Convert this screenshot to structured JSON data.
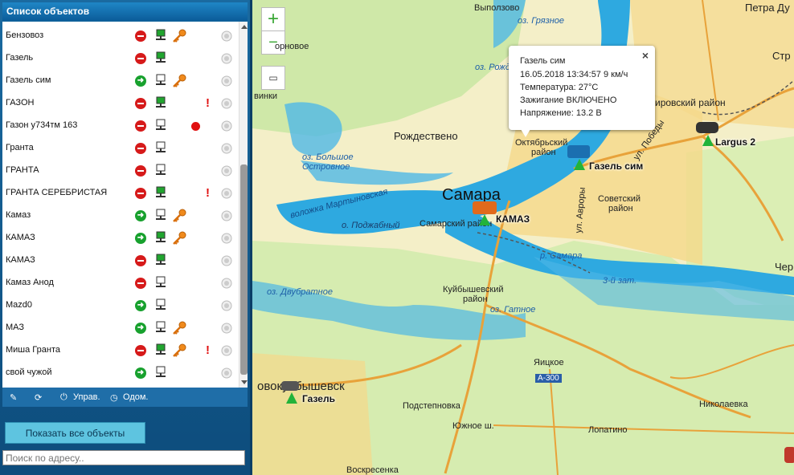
{
  "panel": {
    "title": "Список объектов",
    "objects": [
      {
        "name": "Бензовоз",
        "status": "stopped",
        "gps": true,
        "key": true,
        "alert": false,
        "dot": false
      },
      {
        "name": "Газель",
        "status": "stopped",
        "gps": true,
        "key": false,
        "alert": false,
        "dot": false
      },
      {
        "name": "Газель сим",
        "status": "moving",
        "gps": false,
        "key": true,
        "alert": false,
        "dot": false
      },
      {
        "name": "ГАЗОН",
        "status": "stopped",
        "gps": true,
        "key": false,
        "alert": true,
        "dot": false
      },
      {
        "name": "Газон у734тм 163",
        "status": "stopped",
        "gps": false,
        "key": false,
        "alert": false,
        "dot": true
      },
      {
        "name": "Гранта",
        "status": "stopped",
        "gps": false,
        "key": false,
        "alert": false,
        "dot": false
      },
      {
        "name": "ГРАНТА",
        "status": "stopped",
        "gps": false,
        "key": false,
        "alert": false,
        "dot": false
      },
      {
        "name": "ГРАНТА СЕРЕБРИСТАЯ",
        "status": "stopped",
        "gps": true,
        "key": false,
        "alert": true,
        "dot": false
      },
      {
        "name": "Камаз",
        "status": "moving",
        "gps": false,
        "key": true,
        "alert": false,
        "dot": false
      },
      {
        "name": "КАМАЗ",
        "status": "moving",
        "gps": true,
        "key": true,
        "alert": false,
        "dot": false
      },
      {
        "name": "КАМАЗ",
        "status": "stopped",
        "gps": true,
        "key": false,
        "alert": false,
        "dot": false
      },
      {
        "name": "Камаз Анод",
        "status": "stopped",
        "gps": false,
        "key": false,
        "alert": false,
        "dot": false
      },
      {
        "name": "Mazd0",
        "status": "moving",
        "gps": false,
        "key": false,
        "alert": false,
        "dot": false
      },
      {
        "name": "МАЗ",
        "status": "moving",
        "gps": false,
        "key": true,
        "alert": false,
        "dot": false
      },
      {
        "name": "Миша Гранта",
        "status": "stopped",
        "gps": true,
        "key": true,
        "alert": true,
        "dot": false
      },
      {
        "name": "свой чужой",
        "status": "moving",
        "gps": false,
        "key": false,
        "alert": false,
        "dot": false
      }
    ],
    "toolbar": {
      "control_label": "Управ.",
      "odometer_label": "Одом."
    },
    "show_all_label": "Показать все объекты",
    "search_placeholder": "Поиск по адресу.."
  },
  "map": {
    "zoom_in": "+",
    "zoom_out": "−",
    "popup": {
      "title": "Газель сим",
      "datetime_speed": "16.05.2018 13:34:57 9 км/ч",
      "temperature": "Температура: 27°C",
      "ignition": "Зажигание ВКЛЮЧЕНО",
      "voltage": "Напряжение: 13.2 В"
    },
    "city_label": "Самара",
    "place_labels": {
      "vypolzovo": "Выползово",
      "rozhdestveno": "Рождествено",
      "oktyabrsky": "Октябрьский",
      "oktyabrsky2": "район",
      "kirovsky": "Кировский район",
      "sovetsky": "Советский",
      "sovetsky2": "район",
      "samarsky": "Самарский район",
      "kuibyshevsky": "Куйбышевский",
      "kuibyshevsky2": "район",
      "yaitskoe": "Яицкое",
      "a300": "А-300",
      "podstepnovka": "Подстепновка",
      "yuzhnoe": "Южное ш.",
      "lopatino": "Лопатино",
      "nikolaevka": "Николаевка",
      "voskresenka": "Воскресенка",
      "novokuibyshevsk": "овокуйбышевск",
      "petra_du": "Петра Ду",
      "str": "Стр",
      "cher": "Чер",
      "vinki": "винки",
      "ornovoe": "орновое",
      "pobedy": "ул. Победы",
      "avrory": "ул. Авроры"
    },
    "water_labels": {
      "gryaznoe": "оз. Грязное",
      "rozhdestveno_lake": "оз. Рожде",
      "bolshoe": "оз. Большое",
      "bolshoe2": "Островное",
      "martynovskaya": "воложка Мартыновская",
      "podzhabny": "о. Поджабный",
      "samara_river": "р. Самара",
      "third_zat": "3-й зат.",
      "dvubratnoe": "оз. Двубратное",
      "gatnoe": "оз. Гатное"
    },
    "vehicles": [
      {
        "label": "Газель сим"
      },
      {
        "label": "КАМАЗ"
      },
      {
        "label": "Largus 2"
      },
      {
        "label": "Газель"
      }
    ],
    "colors": {
      "water": "#2ea9e0",
      "land": "#f4efc8",
      "green": "#cfe8a8",
      "urban": "#f5d88a",
      "road": "#e8a23a"
    }
  }
}
